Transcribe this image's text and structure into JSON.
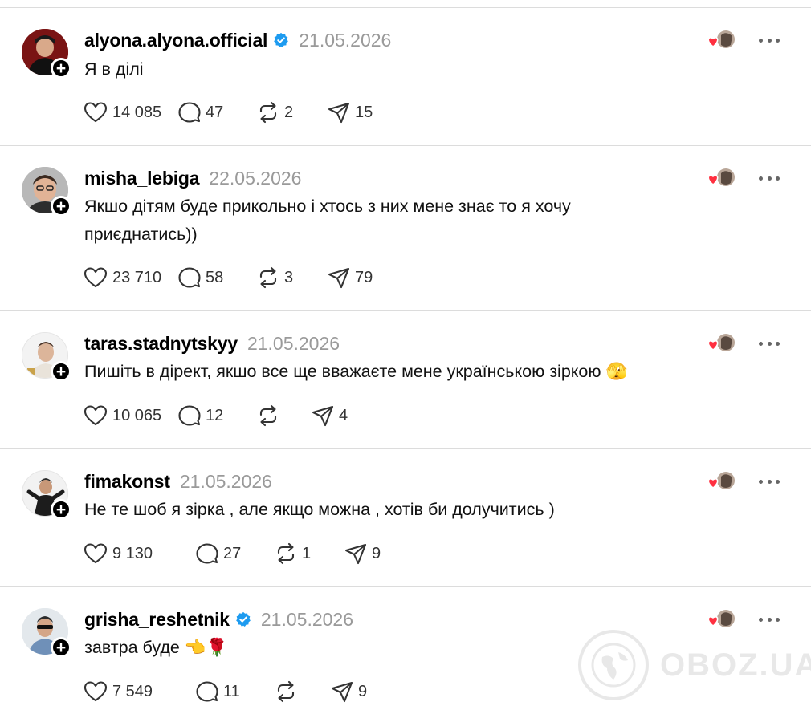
{
  "colors": {
    "heart": "#ff3040",
    "verified": "#1d9bf0",
    "date": "#9a9a9a",
    "divider": "#dcdcdc"
  },
  "posts": [
    {
      "username": "alyona.alyona.official",
      "verified": true,
      "date": "21.05.2026",
      "text": "Я в ділі",
      "likes": "14 085",
      "replies": "47",
      "reposts": "2",
      "shares": "15"
    },
    {
      "username": "misha_lebiga",
      "verified": false,
      "date": "22.05.2026",
      "text": "Якшо дітям буде прикольно і хтось з них мене знає то я хочу приєднатись))",
      "likes": "23 710",
      "replies": "58",
      "reposts": "3",
      "shares": "79"
    },
    {
      "username": "taras.stadnytskyy",
      "verified": false,
      "date": "21.05.2026",
      "text": "Пишіть в дірект, якшо все ще вважаєте мене українською зіркою 🫣",
      "likes": "10 065",
      "replies": "12",
      "reposts": "",
      "shares": "4"
    },
    {
      "username": "fimakonst",
      "verified": false,
      "date": "21.05.2026",
      "text": "Не те шоб я зірка , але якщо можна , хотів би долучитись )",
      "likes": "9 130",
      "replies": "27",
      "reposts": "1",
      "shares": "9"
    },
    {
      "username": "grisha_reshetnik",
      "verified": true,
      "date": "21.05.2026",
      "text": "завтра буде 👈🌹",
      "likes": "7 549",
      "replies": "11",
      "reposts": "",
      "shares": "9"
    }
  ],
  "watermark": {
    "text": "OBOZ.UA"
  }
}
